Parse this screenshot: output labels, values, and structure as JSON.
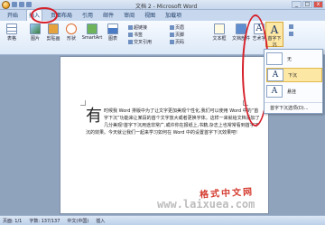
{
  "window": {
    "title": "文档 2 - Microsoft Word"
  },
  "tabs": [
    "开始",
    "插入",
    "页面布局",
    "引用",
    "邮件",
    "审阅",
    "视图",
    "加载项"
  ],
  "ribbon": {
    "buttons": [
      {
        "label": "表格",
        "icon": "table-icon"
      },
      {
        "label": "图片",
        "icon": "picture-icon"
      },
      {
        "label": "剪贴画",
        "icon": "clipart-icon"
      },
      {
        "label": "形状",
        "icon": "shapes-icon"
      },
      {
        "label": "SmartArt",
        "icon": "smartart-icon"
      },
      {
        "label": "图表",
        "icon": "chart-icon"
      },
      {
        "label": "超链接",
        "icon": "hyperlink-icon"
      },
      {
        "label": "书签",
        "icon": "bookmark-icon"
      },
      {
        "label": "交叉引用",
        "icon": "crossref-icon"
      },
      {
        "label": "页眉",
        "icon": "header-icon"
      },
      {
        "label": "页脚",
        "icon": "footer-icon"
      },
      {
        "label": "页码",
        "icon": "pagenum-icon"
      },
      {
        "label": "文本框",
        "icon": "textbox-icon"
      },
      {
        "label": "文档部件",
        "icon": "quickparts-icon"
      }
    ],
    "wordart": "艺术字",
    "dropcap": "首字下沉",
    "wordart_text": "A"
  },
  "dropdown": {
    "items": [
      "无",
      "下沉",
      "悬挂"
    ],
    "option": "首字下沉选项(D)..."
  },
  "document": {
    "dropcap_char": "有",
    "text": "时候我 Word 排版中为了让文字更加美观个性化,我们可以使用 Word 中的“首字下沉”功能来让某段的首个文字放大或者更换字体。这样一来就给文档添加了几分美观!首字下沉用途非常广,或许你在报纸上,书籍,杂志上也常常看到首字下沉的效果。今天就让我们一起来学习如何在 Word 中的设置首字下沉效果吧!",
    "watermark": "格式中文网",
    "site": "www.laixuea.com"
  },
  "status": {
    "page": "页面: 1/1",
    "words": "字数: 137/137",
    "lang": "中文(中国)",
    "insert": "插入"
  },
  "colors": {
    "ring": "#d6202a",
    "highlight": "#fde7a5"
  }
}
